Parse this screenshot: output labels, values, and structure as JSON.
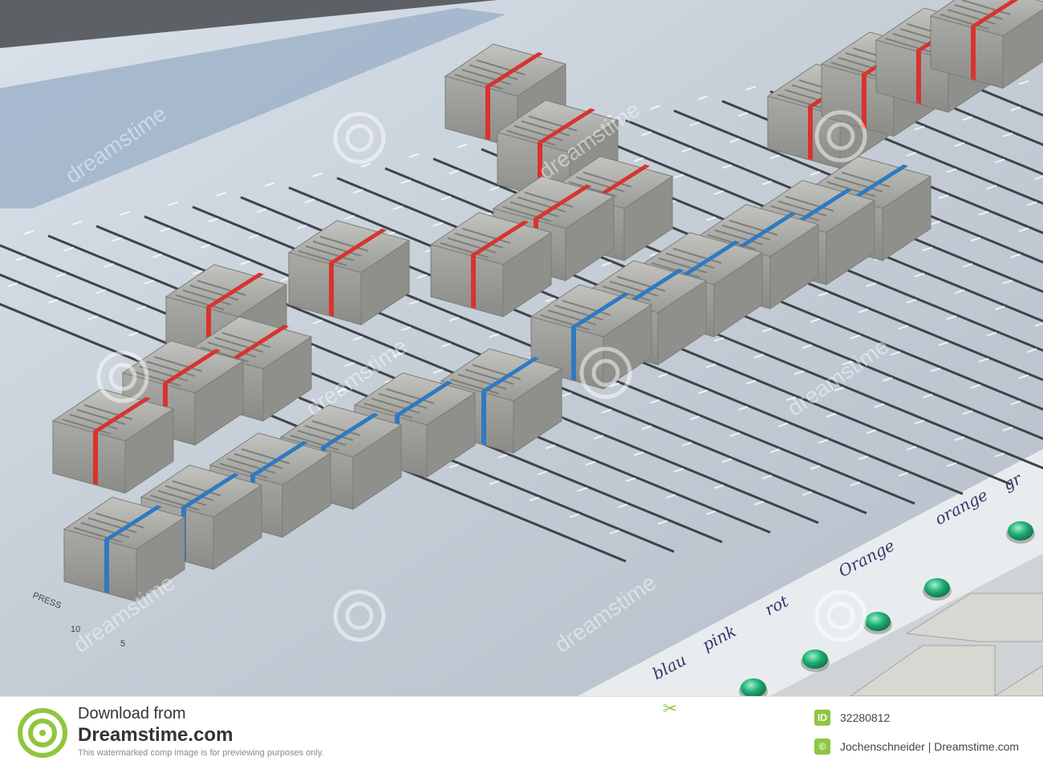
{
  "photo": {
    "console_labels": [
      "PRESS"
    ],
    "scale_marks": [
      "10",
      "5"
    ],
    "handwritten_labels": [
      "blau",
      "pink",
      "rot",
      "Orange",
      "orange",
      "gr"
    ]
  },
  "watermark": {
    "text": "dreamstime"
  },
  "footer": {
    "download_from": "Download from",
    "site_name": "Dreamstime.com",
    "disclaimer": "This watermarked comp image is for previewing purposes only.",
    "image_id": "32280812",
    "credit": "Jochenschneider | Dreamstime.com",
    "id_icon": "ID",
    "copyright_icon": "©"
  },
  "colors": {
    "panel": "#c9d2dc",
    "knob": "#a7a8a3",
    "red_stripe": "#d8332f",
    "blue_stripe": "#2f79c2",
    "led_green": "#1fae74",
    "brand_green": "#8fc63f"
  }
}
